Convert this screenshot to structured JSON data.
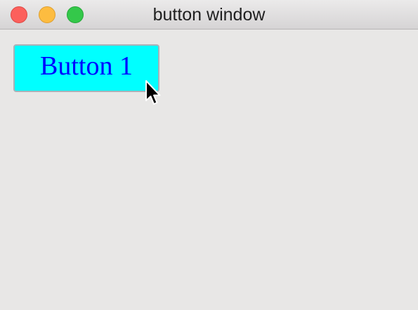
{
  "window": {
    "title": "button window"
  },
  "traffic_lights": {
    "close": "#fc605c",
    "minimize": "#fdbc40",
    "zoom": "#34c84a"
  },
  "button": {
    "label": "Button 1",
    "background": "#00ffff",
    "text_color": "#0000ff"
  },
  "cursor": {
    "icon": "arrow-pointer-icon"
  }
}
